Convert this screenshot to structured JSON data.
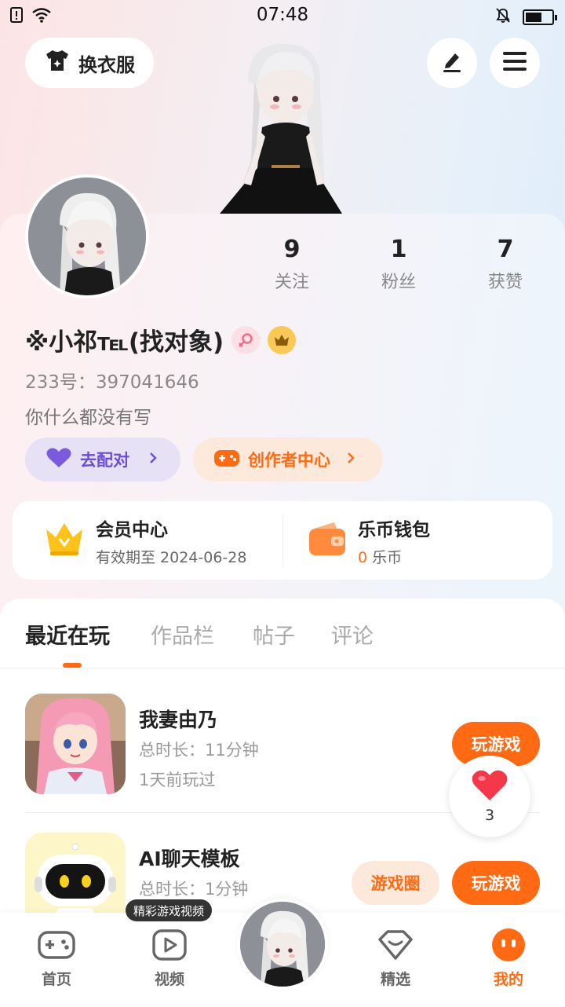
{
  "status_bar": {
    "time": "07:48"
  },
  "header": {
    "outfit_label": "换衣服"
  },
  "stats": [
    {
      "num": "9",
      "label": "关注"
    },
    {
      "num": "1",
      "label": "粉丝"
    },
    {
      "num": "7",
      "label": "获赞"
    }
  ],
  "profile": {
    "name": "※小祁℡(找对象)",
    "uid": "233号：397041646",
    "bio": "你什么都没有写"
  },
  "actions": {
    "match_label": "去配对",
    "creator_label": "创作者中心"
  },
  "vip": {
    "title": "会员中心",
    "expiry": "有效期至 2024-06-28"
  },
  "wallet": {
    "title": "乐币钱包",
    "amount": "0",
    "unit": "乐币"
  },
  "tabs": [
    "最近在玩",
    "作品栏",
    "帖子",
    "评论"
  ],
  "games": [
    {
      "name": "我妻由乃",
      "duration": "总时长：11分钟",
      "last_played": "1天前玩过",
      "play_label": "玩游戏"
    },
    {
      "name": "AI聊天模板",
      "duration": "总时长：1分钟",
      "last_played": "",
      "play_label": "玩游戏",
      "circle_label": "游戏圈"
    }
  ],
  "like_float": {
    "count": "3"
  },
  "tooltip": "精彩游戏视频",
  "nav": [
    {
      "label": "首页"
    },
    {
      "label": "视频"
    },
    {
      "label": "精选"
    },
    {
      "label": "我的"
    }
  ],
  "colors": {
    "accent": "#ff6a13",
    "match": "#6a4fd6",
    "match_bg": "#e7e1f6",
    "creator_bg": "#fde9dc"
  }
}
